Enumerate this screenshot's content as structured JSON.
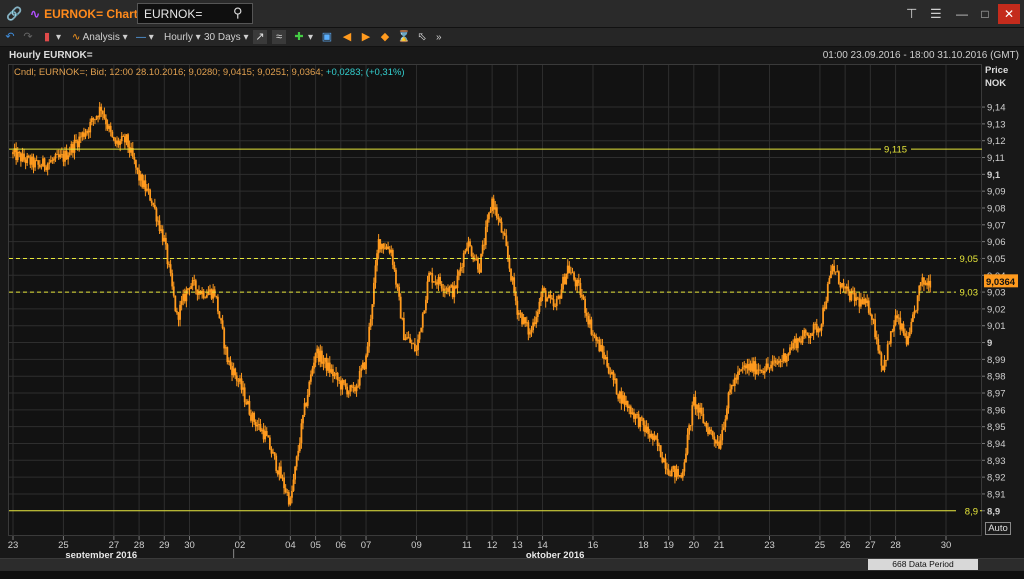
{
  "window": {
    "app_icon": "chain-link-icon",
    "app_title": "EURNOK= Chart",
    "ric_value": "EURNOK=",
    "search_icon": "search-icon"
  },
  "toolbar": {
    "analysis_label": "Analysis",
    "interval_label": "Hourly",
    "range_label": "30 Days"
  },
  "chart_header": {
    "subtitle": "Hourly EURNOK=",
    "date_range": "01:00 23.09.2016 - 18:00 31.10.2016 (GMT)",
    "legend_text": "Cndl; EURNOK=; Bid; 12:00 28.10.2016; 9,0280; 9,0415; 9,0251; 9,0364;",
    "legend_change": "+0,0283; (+0,31%)",
    "price_label": "Price",
    "currency_label": "NOK",
    "auto_label": "Auto"
  },
  "status": {
    "data_period": "668 Data Period"
  },
  "colors": {
    "candle": "#ff9a1e",
    "hline": "#e6e63a",
    "last_price_bg": "#ff9a1e",
    "grid": "#2e2e2e"
  },
  "chart_data": {
    "type": "candlestick",
    "ylim": [
      8.885,
      9.165
    ],
    "y_ticks": [
      "9,14",
      "9,13",
      "9,12",
      "9,11",
      "9,1",
      "9,09",
      "9,08",
      "9,07",
      "9,06",
      "9,05",
      "9,04",
      "9,03",
      "9,02",
      "9,01",
      "9",
      "8,99",
      "8,98",
      "8,97",
      "8,96",
      "8,95",
      "8,94",
      "8,93",
      "8,92",
      "8,91",
      "8,9"
    ],
    "y_tick_values": [
      9.14,
      9.13,
      9.12,
      9.11,
      9.1,
      9.09,
      9.08,
      9.07,
      9.06,
      9.05,
      9.04,
      9.03,
      9.02,
      9.01,
      9.0,
      8.99,
      8.98,
      8.97,
      8.96,
      8.95,
      8.94,
      8.93,
      8.92,
      8.91,
      8.9
    ],
    "x_ticks": [
      "23",
      "25",
      "27",
      "28",
      "29",
      "30",
      "02",
      "04",
      "05",
      "06",
      "07",
      "09",
      "11",
      "12",
      "13",
      "14",
      "16",
      "18",
      "19",
      "20",
      "21",
      "23",
      "25",
      "26",
      "27",
      "28",
      "30"
    ],
    "x_tick_index": [
      0,
      2,
      4,
      5,
      6,
      7,
      9,
      11,
      12,
      13,
      14,
      16,
      18,
      19,
      20,
      21,
      23,
      25,
      26,
      27,
      28,
      30,
      32,
      33,
      34,
      35,
      37
    ],
    "month_labels": [
      "september 2016",
      "oktober 2016"
    ],
    "month_label_index": [
      3.5,
      21.5
    ],
    "horizontal_lines": [
      {
        "value": 9.115,
        "label": "9,115",
        "style": "solid"
      },
      {
        "value": 9.05,
        "label": "9,05",
        "style": "dashed"
      },
      {
        "value": 9.03,
        "label": "9,03",
        "style": "dashed"
      },
      {
        "value": 8.9,
        "label": "8,9",
        "style": "solid"
      }
    ],
    "last_price": {
      "value": 9.0364,
      "label": "9,0364"
    },
    "path_days": [
      0,
      1,
      2,
      3,
      3.5,
      4,
      4.5,
      5,
      5.5,
      6,
      6.5,
      7,
      7.5,
      8,
      8.5,
      9,
      9.5,
      10,
      10.5,
      11,
      11.5,
      12,
      12.5,
      13,
      13.5,
      14,
      14.5,
      15,
      15.5,
      16,
      16.5,
      17,
      17.5,
      18,
      18.5,
      19,
      19.5,
      20,
      20.5,
      21,
      21.5,
      22,
      22.5,
      23,
      23.5,
      24,
      24.5,
      25,
      25.5,
      26,
      26.5,
      27,
      27.5,
      28,
      28.5,
      29,
      29.5,
      30,
      30.5,
      31,
      31.5,
      32,
      32.5,
      33,
      33.5,
      34,
      34.5,
      35,
      35.5,
      36,
      36.4
    ],
    "path_closes": [
      9.112,
      9.105,
      9.11,
      9.128,
      9.14,
      9.118,
      9.12,
      9.098,
      9.085,
      9.06,
      9.015,
      9.035,
      9.03,
      9.03,
      8.99,
      8.975,
      8.955,
      8.945,
      8.925,
      8.905,
      8.955,
      8.995,
      8.985,
      8.975,
      8.97,
      8.99,
      9.06,
      9.055,
      9.005,
      8.995,
      9.04,
      9.035,
      9.03,
      9.06,
      9.045,
      9.085,
      9.06,
      9.02,
      9.005,
      9.03,
      9.02,
      9.045,
      9.03,
      9.005,
      8.99,
      8.97,
      8.96,
      8.95,
      8.94,
      8.925,
      8.92,
      8.965,
      8.95,
      8.94,
      8.975,
      8.985,
      8.985,
      8.985,
      8.99,
      9.0,
      9.005,
      9.01,
      9.045,
      9.03,
      9.025,
      9.02,
      8.985,
      9.015,
      9.0,
      9.035,
      9.0364
    ]
  }
}
